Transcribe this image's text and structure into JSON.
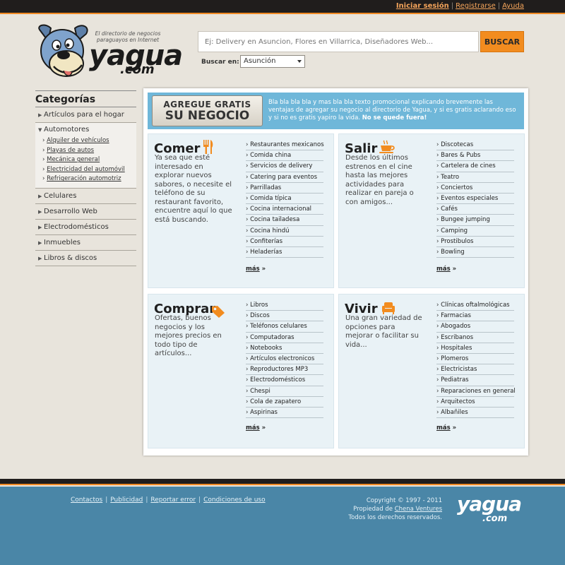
{
  "topbar": {
    "login": "Iniciar sesión",
    "register": "Registrarse",
    "help": "Ayuda",
    "separator": "|"
  },
  "logo": {
    "tagline": "El directorio de negocios paraguayos en Internet",
    "word": "yagua",
    "domain": ".com"
  },
  "search": {
    "placeholder": "Ej: Delivery en Asuncion, Flores en Villarrica, Diseñadores Web...",
    "button": "BUSCAR",
    "in_label": "Buscar en:",
    "location": "Asunción"
  },
  "sidebar": {
    "title": "Categorías",
    "before": [
      "Artículos para el hogar"
    ],
    "open": {
      "label": "Automotores",
      "subs": [
        "Alquiler de vehículos",
        "Playas de autos",
        "Mecánica general",
        "Electricidad del automóvil",
        "Refrigeración automotriz"
      ]
    },
    "after": [
      "Celulares",
      "Desarrollo Web",
      "Electrodomésticos",
      "Inmuebles",
      "Libros & discos"
    ]
  },
  "promo": {
    "button_line1": "AGREGUE GRATIS",
    "button_line2": "SU NEGOCIO",
    "text": "Bla bla bla bla y mas bla bla texto promocional explicando brevemente las ventajas de agregar su negocio al directorio de Yagua, y si es gratis aclarando eso y si no es gratis yapiro la vida.",
    "text_bold": "No se quede fuera!"
  },
  "cards": {
    "comer": {
      "title": "Comer",
      "icon": "utensils-icon",
      "desc": "Ya sea que esté interesado en explorar nuevos sabores, o necesite el teléfono de su restaurant favorito, encuentre aquí lo que está buscando.",
      "items": [
        "Restaurantes mexicanos",
        "Comida china",
        "Servicios de delivery",
        "Catering para eventos",
        "Parrilladas",
        "Comida típica",
        "Cocina internacional",
        "Cocina tailadesa",
        "Cocina hindú",
        "Confiterías",
        "Heladerías"
      ],
      "more": "más"
    },
    "salir": {
      "title": "Salir",
      "icon": "coffee-cup-icon",
      "desc": "Desde los últimos estrenos en el cine hasta las mejores actividades para realizar en pareja o con amigos...",
      "items": [
        "Discotecas",
        "Bares & Pubs",
        "Cartelera de cines",
        "Teatro",
        "Conciertos",
        "Eventos especiales",
        "Cafés",
        "Bungee jumping",
        "Camping",
        "Prostibulos",
        "Bowling"
      ],
      "more": "más"
    },
    "comprar": {
      "title": "Comprar",
      "icon": "price-tag-icon",
      "desc": "Ofertas, buenos negocios y los mejores precios en todo tipo de artículos...",
      "items": [
        "Libros",
        "Discos",
        "Teléfonos celulares",
        "Computadoras",
        "Notebooks",
        "Artículos electronicos",
        "Reproductores MP3",
        "Electrodomésticos",
        "Chespi",
        "Cola de zapatero",
        "Aspirinas"
      ],
      "more": "más"
    },
    "vivir": {
      "title": "Vivir",
      "icon": "armchair-icon",
      "desc": "Una gran variedad de opciones para mejorar o facilitar su vida...",
      "items": [
        "Clínicas oftalmológicas",
        "Farmacias",
        "Abogados",
        "Escribanos",
        "Hospitales",
        "Plomeros",
        "Electricistas",
        "Pediatras",
        "Reparaciones en general",
        "Arquitectos",
        "Albañiles"
      ],
      "more": "más"
    }
  },
  "footer": {
    "links": [
      "Contactos",
      "Publicidad",
      "Reportar error",
      "Condiciones de uso"
    ],
    "copyright": "Copyright © 1997 - 2011",
    "property_prefix": "Propiedad de",
    "property_owner": "Chena Ventures",
    "rights": "Todos los derechos reservados.",
    "logo_word": "yagua",
    "logo_domain": ".com"
  },
  "colors": {
    "accent_orange": "#f28c1f",
    "promo_blue": "#6fb7d9",
    "footer_blue": "#4a86a7",
    "topbar": "#201d1c"
  }
}
